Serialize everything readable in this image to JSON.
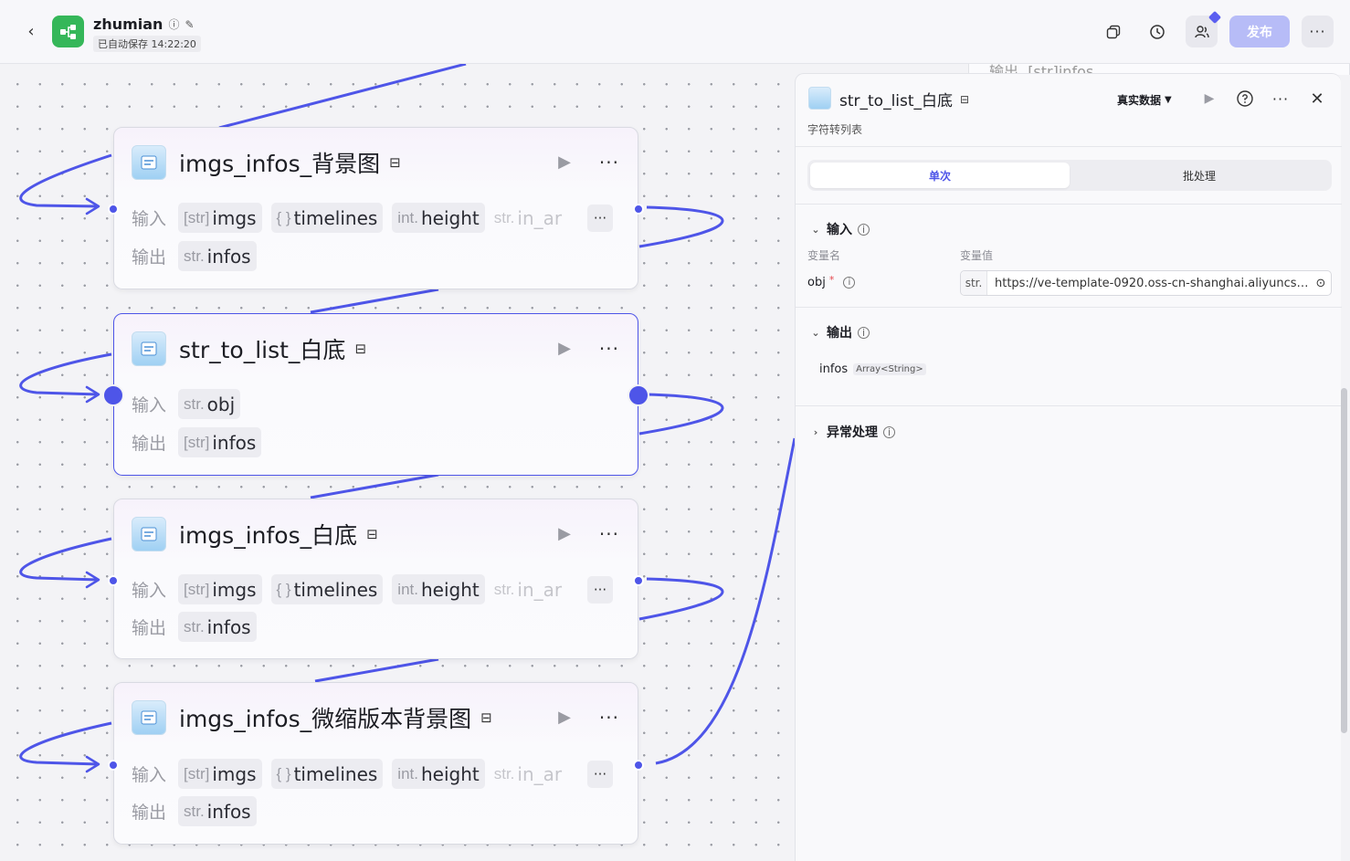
{
  "header": {
    "app_name": "zhumian",
    "autosave": "已自动保存 14:22:20",
    "publish": "发布",
    "more": "···"
  },
  "nodes": [
    {
      "title": "imgs_infos_背景图",
      "in_label": "输入",
      "out_label": "输出",
      "inputs": [
        {
          "type": "[str]",
          "name": "imgs"
        },
        {
          "type": "{ }",
          "name": "timelines"
        },
        {
          "type": "int.",
          "name": "height"
        },
        {
          "type": "str.",
          "name": "in_ar"
        }
      ],
      "outputs": [
        {
          "type": "str.",
          "name": "infos"
        }
      ]
    },
    {
      "title": "str_to_list_白底",
      "in_label": "输入",
      "out_label": "输出",
      "inputs": [
        {
          "type": "str.",
          "name": "obj"
        }
      ],
      "outputs": [
        {
          "type": "[str]",
          "name": "infos"
        }
      ]
    },
    {
      "title": "imgs_infos_白底",
      "in_label": "输入",
      "out_label": "输出",
      "inputs": [
        {
          "type": "[str]",
          "name": "imgs"
        },
        {
          "type": "{ }",
          "name": "timelines"
        },
        {
          "type": "int.",
          "name": "height"
        },
        {
          "type": "str.",
          "name": "in_ar"
        }
      ],
      "outputs": [
        {
          "type": "str.",
          "name": "infos"
        }
      ]
    },
    {
      "title": "imgs_infos_微缩版本背景图",
      "in_label": "输入",
      "out_label": "输出",
      "inputs": [
        {
          "type": "[str]",
          "name": "imgs"
        },
        {
          "type": "{ }",
          "name": "timelines"
        },
        {
          "type": "int.",
          "name": "height"
        },
        {
          "type": "str.",
          "name": "in_ar"
        }
      ],
      "outputs": [
        {
          "type": "str.",
          "name": "infos"
        }
      ]
    }
  ],
  "behind_panel": {
    "out_label": "输出",
    "chip_type": "[str]",
    "chip_name": "infos"
  },
  "panel": {
    "title": "str_to_list_白底",
    "description": "字符转列表",
    "data_mode": "真实数据",
    "tabs": [
      {
        "label": "单次"
      },
      {
        "label": "批处理"
      }
    ],
    "input_section": "输入",
    "col_name": "变量名",
    "col_value": "变量值",
    "var_name": "obj",
    "var_required": "*",
    "var_type": "str.",
    "var_value": "https://ve-template-0920.oss-cn-shanghai.aliyuncs.com/...",
    "output_section": "输出",
    "out_name": "infos",
    "out_type": "Array<String>",
    "error_section": "异常处理"
  },
  "colors": {
    "accent": "#4e55e8",
    "publish_disabled": "#b7bcf7",
    "logo_green": "#35b759"
  }
}
